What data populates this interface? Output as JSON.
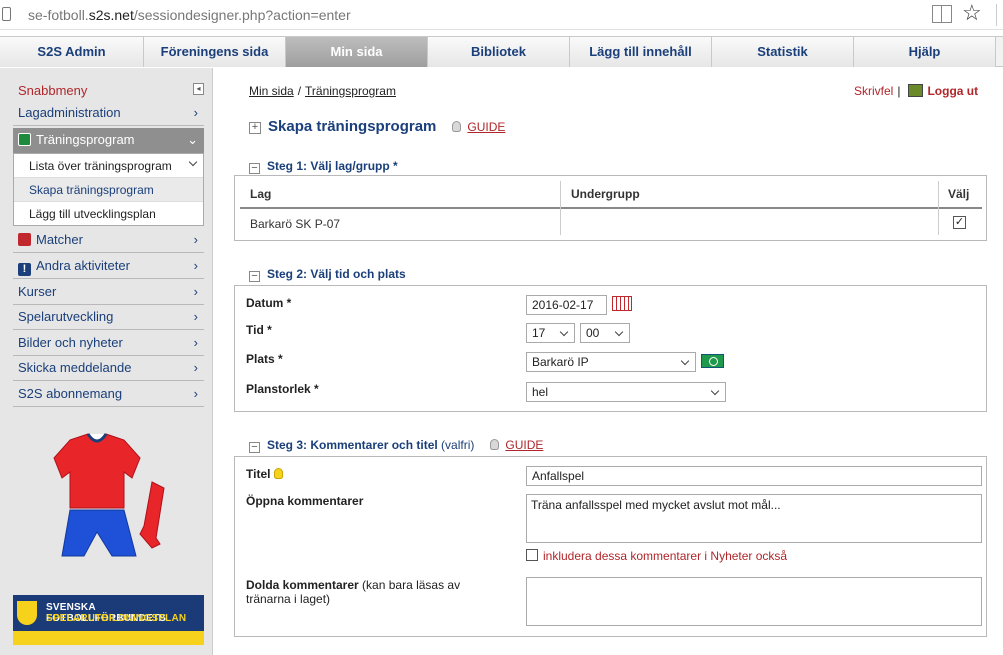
{
  "browser": {
    "url_prefix": "se-fotboll.",
    "url_domain": "s2s.net",
    "url_path": "/sessiondesigner.php?action=enter"
  },
  "topnav": [
    "S2S Admin",
    "Föreningens sida",
    "Min sida",
    "Bibliotek",
    "Lägg till innehåll",
    "Statistik",
    "Hjälp"
  ],
  "sidebar": {
    "title": "Snabbmeny",
    "items": {
      "lagadmin": "Lagadministration",
      "traningsprogram": "Träningsprogram",
      "matcher": "Matcher",
      "andra": "Andra aktiviteter",
      "kurser": "Kurser",
      "spelarutveckling": "Spelarutveckling",
      "bilder": "Bilder och nyheter",
      "skicka": "Skicka meddelande",
      "abonnemang": "S2S abonnemang"
    },
    "submenu": [
      "Lista över träningsprogram",
      "Skapa träningsprogram",
      "Lägg till utvecklingsplan"
    ],
    "banner_line1": "SVENSKA FOTBOLLFÖRBUNDETS",
    "banner_line2": "SPELARUTBILDNINGSPLAN"
  },
  "breadcrumb": {
    "home": "Min sida",
    "current": "Träningsprogram"
  },
  "toplinks": {
    "print": "Skrivfel",
    "logout": "Logga ut"
  },
  "page": {
    "title": "Skapa träningsprogram",
    "guide": "GUIDE"
  },
  "step1": {
    "heading": "Steg 1: Välj lag/grupp *",
    "columns": [
      "Lag",
      "Undergrupp",
      "Välj"
    ],
    "row": {
      "lag": "Barkarö SK P-07",
      "undergrupp": "",
      "checked": true
    }
  },
  "step2": {
    "heading": "Steg 2: Välj tid och plats",
    "datum_label": "Datum *",
    "datum_value": "2016-02-17",
    "tid_label": "Tid *",
    "tid_hour": "17",
    "tid_min": "00",
    "plats_label": "Plats *",
    "plats_value": "Barkarö IP",
    "plan_label": "Planstorlek *",
    "plan_value": "hel"
  },
  "step3": {
    "heading": "Steg 3: Kommentarer och titel",
    "heading_opt": "(valfri)",
    "guide": "GUIDE",
    "titel_label": "Titel",
    "titel_value": "Anfallspel",
    "open_label": "Öppna kommentarer",
    "open_value": "Träna anfallsspel med mycket avslut mot mål...",
    "include_label": "inkludera dessa kommentarer i Nyheter också",
    "hidden_label": "Dolda kommentarer",
    "hidden_note": "(kan bara läsas av tränarna i laget)",
    "hidden_value": ""
  }
}
